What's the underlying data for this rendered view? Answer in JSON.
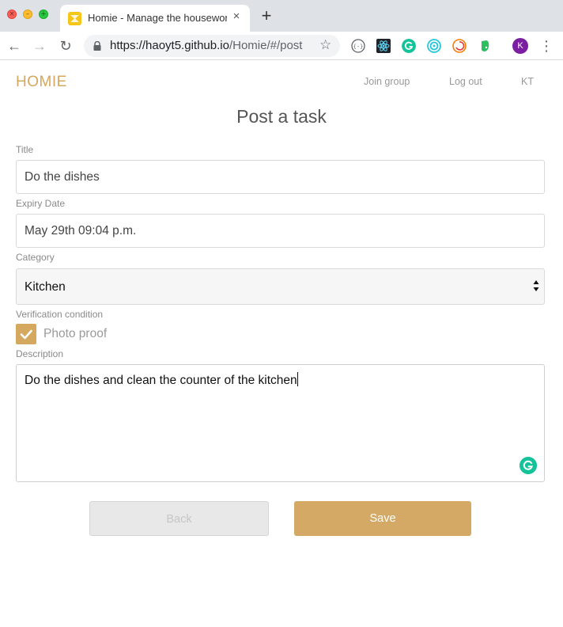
{
  "browser": {
    "tab_title": "Homie - Manage the housework",
    "tab_close": "×",
    "new_tab": "+",
    "url_host": "https://haoyt5.github.io",
    "url_path": "/Homie/#/post",
    "avatar_initial": "K",
    "icons": [
      "back-icon",
      "forward-icon",
      "reload-icon",
      "lock-icon",
      "bookmark-star-icon",
      "extension-icons",
      "menu-icon"
    ]
  },
  "header": {
    "brand": "HOMIE",
    "nav": [
      "Join group",
      "Log out",
      "KT"
    ]
  },
  "form": {
    "page_title": "Post a task",
    "title_label": "Title",
    "title_value": "Do the dishes",
    "expiry_label": "Expiry Date",
    "expiry_value": "May 29th 09:04 p.m.",
    "category_label": "Category",
    "category_value": "Kitchen",
    "verification_label": "Verification condition",
    "photo_proof_label": "Photo proof",
    "photo_proof_checked": true,
    "description_label": "Description",
    "description_value": "Do the dishes and clean the counter of the kitchen",
    "back_label": "Back",
    "save_label": "Save"
  },
  "colors": {
    "brand": "#d4a85e",
    "save_button": "#d4a865",
    "grammarly": "#15c39a",
    "avatar": "#7b1fa2"
  }
}
